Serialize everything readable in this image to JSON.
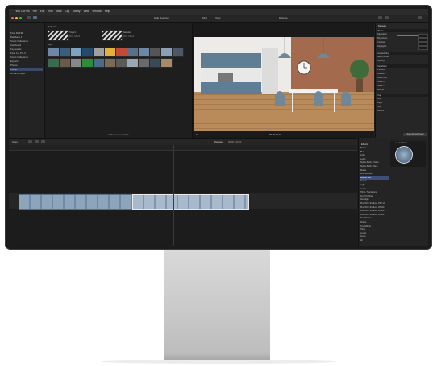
{
  "menubar": {
    "apple": "",
    "items": [
      "Final Cut Pro",
      "File",
      "Edit",
      "Trim",
      "Mark",
      "Clip",
      "Modify",
      "View",
      "Window",
      "Help"
    ],
    "clock": ""
  },
  "toolbar": {
    "left_label": "Hide Rejected",
    "zoom": "64%",
    "view_label": "View",
    "center_label": "Daisuke",
    "project_label": ""
  },
  "sidebar": {
    "items": [
      {
        "label": "Final ROFM",
        "selected": false
      },
      {
        "label": "Databank 1",
        "selected": false
      },
      {
        "label": "Smart Collections",
        "selected": false
      },
      {
        "label": "Cardboard",
        "selected": false
      },
      {
        "label": "Keyboards",
        "selected": false
      },
      {
        "label": "Final Cut Pro X",
        "selected": false
      },
      {
        "label": "Smart Collections",
        "selected": false
      },
      {
        "label": "Exports",
        "selected": false
      },
      {
        "label": "Photos",
        "selected": false
      },
      {
        "label": "Bridge",
        "selected": true
      },
      {
        "label": "A Plain Project",
        "selected": false
      }
    ]
  },
  "browser": {
    "section_projects": "Projects",
    "section_clips": "Clips",
    "projects": [
      {
        "name": "Project 1",
        "meta": "2019-04-21"
      },
      {
        "name": "Daisuke",
        "meta": "2019-04-21"
      }
    ],
    "status": "1 of 18 selected, 00:00"
  },
  "viewer": {
    "timecode": "00:00:15:10",
    "zoom": "Fit"
  },
  "inspector": {
    "title": "Daisuke",
    "sections": [
      {
        "name": "Effects",
        "rows": [
          "Saturation",
          "Brightness",
          "Contrast",
          "Highlights"
        ]
      },
      {
        "name": "Compositing",
        "rows": [
          "Blend Mode",
          "Opacity"
        ]
      },
      {
        "name": "Transform",
        "rows": [
          "Position",
          "Rotation",
          "Scale (All)",
          "Scale X",
          "Scale Y",
          "Anchor"
        ]
      },
      {
        "name": "Crop",
        "rows": [
          "Left",
          "Right",
          "Top",
          "Bottom"
        ]
      }
    ],
    "save_button": "Save Effects Preset"
  },
  "timeline_bar": {
    "index_label": "Index",
    "project_name": "Daisuke",
    "duration": "00:00 / 00:00"
  },
  "effects": {
    "title": "Effects",
    "thumb_label": "Levels Effects",
    "categories": [
      "Basics",
      "Blur",
      "Light",
      "Looks",
      "Stylize Before Video",
      "Stylize Before Next",
      "Masks",
      "Blur/Shadows",
      "Blurred Edit",
      "Keyers",
      "Light",
      "Looks",
      "Tiling / Transitions",
      "Ken Of Effects",
      "Nostalgia",
      "Pixel Film Studios - PFX VL",
      "Pixel Film Studios - ROLM",
      "Pixel Film Studios - ROLM",
      "Pixel Film Studios - ROLM",
      "Stabilization",
      "Stylize",
      "Text Effects",
      "Tiling",
      "Levels",
      "Audio",
      "All"
    ],
    "selected_index": 8,
    "count_label": "26 items"
  },
  "colors": {
    "accent_blue": "#3d4f7a",
    "playhead": "#e2b23a",
    "clip_border": "#6a8fcf"
  }
}
